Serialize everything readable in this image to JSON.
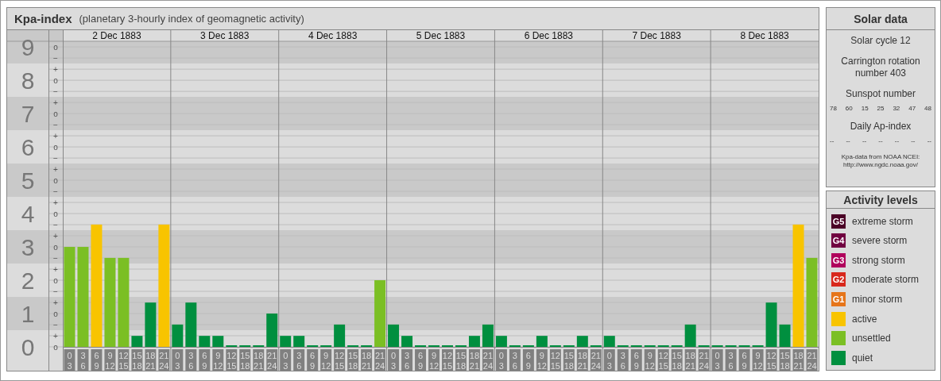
{
  "main_panel": {
    "title": "Kpa-index",
    "subtitle": "(planetary 3-hourly index of geomagnetic activity)",
    "chart": {
      "days": [
        "2 Dec 1883",
        "3 Dec 1883",
        "4 Dec 1883",
        "5 Dec 1883",
        "6 Dec 1883",
        "7 Dec 1883",
        "8 Dec 1883"
      ],
      "y_marks": [
        "o",
        "−",
        "+",
        "o",
        "−",
        "+",
        "o",
        "−",
        "+",
        "o",
        "−",
        "+",
        "o",
        "−",
        "+",
        "o",
        "−",
        "+",
        "o",
        "−",
        "+",
        "o",
        "−",
        "+",
        "o",
        "−",
        "+",
        "o"
      ],
      "chart_data": {
        "type": "bar",
        "grid": true,
        "ylim": [
          0,
          9.17
        ],
        "yticks": [
          0,
          1,
          2,
          3,
          4,
          5,
          6,
          7,
          8,
          9
        ],
        "categories": [
          "0 3",
          "3 6",
          "6 9",
          "9 12",
          "12 15",
          "15 18",
          "18 21",
          "21 24",
          "0 3",
          "3 6",
          "6 9",
          "9 12",
          "12 15",
          "15 18",
          "18 21",
          "21 24",
          "0 3",
          "3 6",
          "6 9",
          "9 12",
          "12 15",
          "15 18",
          "18 21",
          "21 24",
          "0 3",
          "3 6",
          "6 9",
          "9 12",
          "12 15",
          "15 18",
          "18 21",
          "21 24",
          "0 3",
          "3 6",
          "6 9",
          "9 12",
          "12 15",
          "15 18",
          "18 21",
          "21 24",
          "0 3",
          "3 6",
          "6 9",
          "9 12",
          "12 15",
          "15 18",
          "18 21",
          "21 24",
          "0 3",
          "3 6",
          "6 9",
          "9 12",
          "12 15",
          "15 18",
          "18 21",
          "21 24"
        ],
        "series": [
          {
            "color": "#008f3f",
            "values": [
              null,
              null,
              null,
              null,
              null,
              0.33,
              1.33,
              null,
              0.67,
              1.33,
              0.33,
              0.33,
              0,
              0,
              0,
              1,
              0.33,
              0.33,
              0,
              0,
              0.67,
              0,
              0,
              null,
              0.67,
              0.33,
              0,
              0,
              0,
              0,
              0.33,
              0.67,
              0.33,
              0,
              0,
              0.33,
              0,
              0,
              0.33,
              0,
              0.33,
              0,
              0,
              0,
              0,
              0,
              0.67,
              0,
              0,
              0,
              0,
              0,
              1.33,
              0.67,
              null,
              null
            ]
          },
          {
            "color": "#7bbf24",
            "values": [
              3,
              3,
              null,
              2.67,
              2.67,
              null,
              null,
              null,
              null,
              null,
              null,
              null,
              null,
              null,
              null,
              null,
              null,
              null,
              null,
              null,
              null,
              null,
              null,
              2,
              null,
              null,
              null,
              null,
              null,
              null,
              null,
              null,
              null,
              null,
              null,
              null,
              null,
              null,
              null,
              null,
              null,
              null,
              null,
              null,
              null,
              null,
              null,
              null,
              null,
              null,
              null,
              null,
              null,
              null,
              null,
              2.67
            ]
          },
          {
            "color": "#f8c400",
            "values": [
              null,
              null,
              3.67,
              null,
              null,
              null,
              null,
              3.67,
              null,
              null,
              null,
              null,
              null,
              null,
              null,
              null,
              null,
              null,
              null,
              null,
              null,
              null,
              null,
              null,
              null,
              null,
              null,
              null,
              null,
              null,
              null,
              null,
              null,
              null,
              null,
              null,
              null,
              null,
              null,
              null,
              null,
              null,
              null,
              null,
              null,
              null,
              null,
              null,
              null,
              null,
              null,
              null,
              null,
              null,
              3.67,
              null
            ]
          }
        ]
      }
    }
  },
  "solar_data": {
    "title": "Solar data",
    "lines": [
      "Solar cycle 12",
      "Carrington rotation number 403"
    ],
    "sunspot_label": "Sunspot number",
    "sunspots": [
      "78",
      "60",
      "15",
      "25",
      "32",
      "47",
      "48"
    ],
    "ap_label": "Daily Ap-index",
    "ap_values": [
      "--",
      "--",
      "--",
      "--",
      "--",
      "--",
      "--"
    ],
    "source": "Kpa-data from NOAA NCEI:",
    "source_url": "http://www.ngdc.noaa.gov/"
  },
  "activity_levels": {
    "title": "Activity levels",
    "items": [
      {
        "kind": "storm",
        "code": "G5",
        "label": "extreme storm",
        "color": "#4b0026"
      },
      {
        "kind": "storm",
        "code": "G4",
        "label": "severe storm",
        "color": "#700040"
      },
      {
        "kind": "storm",
        "code": "G3",
        "label": "strong storm",
        "color": "#b0005c"
      },
      {
        "kind": "storm",
        "code": "G2",
        "label": "moderate storm",
        "color": "#d8281c"
      },
      {
        "kind": "storm",
        "code": "G1",
        "label": "minor storm",
        "color": "#e6751a"
      },
      {
        "kind": "level",
        "label": "active",
        "color": "#f8c400"
      },
      {
        "kind": "level",
        "label": "unsettled",
        "color": "#7bbf24"
      },
      {
        "kind": "level",
        "label": "quiet",
        "color": "#008f3f"
      }
    ]
  }
}
